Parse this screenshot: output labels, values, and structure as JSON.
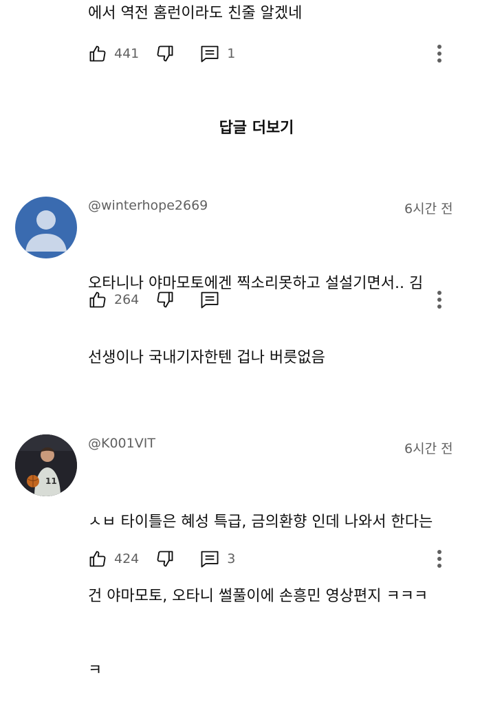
{
  "comments": [
    {
      "text": "에서 역전 홈런이라도 친줄 알겠네",
      "likes": "441",
      "replies": "1"
    },
    {
      "handle": "@winterhope2669",
      "time": "6시간 전",
      "text_line1": "오타니나 야마모토에겐 찍소리못하고 설설기면서.. 김",
      "text_line2": "선생이나 국내기자한텐 겁나 버릇없음",
      "likes": "264"
    },
    {
      "handle": "@K001VIT",
      "time": "6시간 전",
      "text_line1": "ㅅㅂ 타이틀은 혜성 특급, 금의환향 인데 나와서 한다는",
      "text_line2": "건 야마모토, 오타니 썰풀이에 손흥민 영상편지 ㅋㅋㅋ",
      "text_line3": "ㅋ",
      "likes": "424",
      "replies": "3"
    }
  ],
  "more_replies_label": "답글 더보기",
  "icons": [
    "like-icon",
    "dislike-icon",
    "reply-icon",
    "more-options-icon",
    "default-avatar-icon"
  ]
}
